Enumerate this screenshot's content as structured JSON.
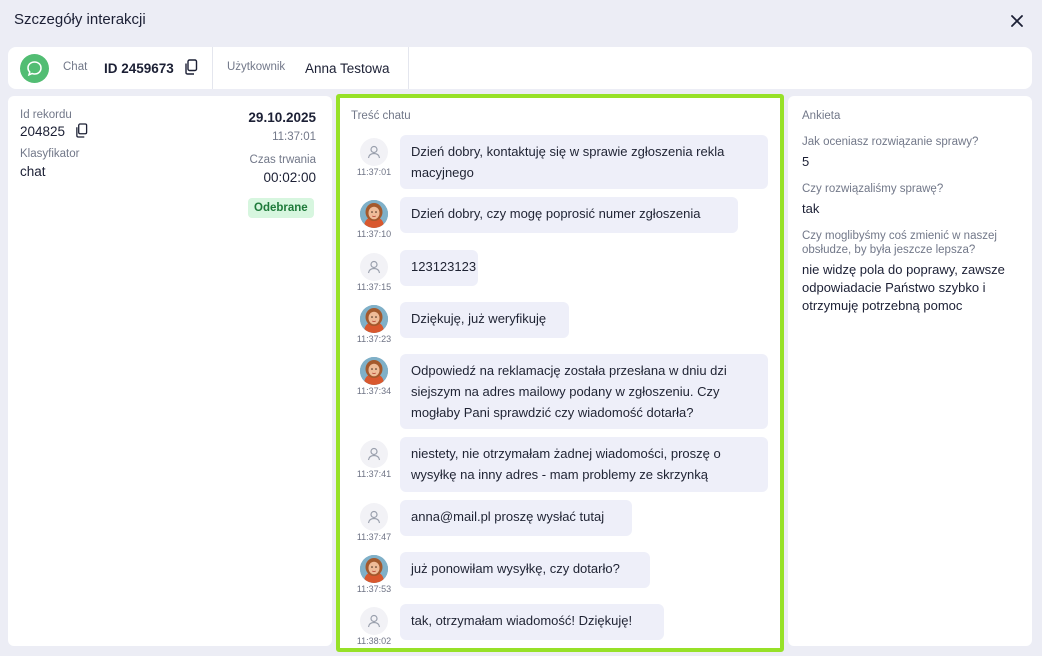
{
  "window": {
    "title": "Szczegóły interakcji"
  },
  "info_bar": {
    "type_label": "Chat",
    "interaction_id": "ID 2459673",
    "user_label": "Użytkownik",
    "user_name": "Anna Testowa"
  },
  "record": {
    "id_label": "Id rekordu",
    "id_value": "204825",
    "classifier_label": "Klasyfikator",
    "classifier_value": "chat",
    "date": "29.10.2025",
    "time": "11:37:01",
    "duration_label": "Czas trwania",
    "duration_value": "00:02:00",
    "status": "Odebrane"
  },
  "chat": {
    "section_label": "Treść chatu",
    "messages": [
      {
        "sender": "client",
        "time": "11:37:01",
        "text": "Dzień dobry, kontaktuję się w sprawie zgłoszenia rekla macyjnego"
      },
      {
        "sender": "agent",
        "time": "11:37:10",
        "text": "Dzień dobry, czy mogę poprosić numer zgłoszenia"
      },
      {
        "sender": "client",
        "time": "11:37:15",
        "text": "123123123"
      },
      {
        "sender": "agent",
        "time": "11:37:23",
        "text": "Dziękuję, już weryfikuję"
      },
      {
        "sender": "agent",
        "time": "11:37:34",
        "text": "Odpowiedź na reklamację została przesłana w dniu dzi siejszym na adres mailowy podany w zgłoszeniu. Czy mogłaby Pani sprawdzić czy wiadomość dotarła?"
      },
      {
        "sender": "client",
        "time": "11:37:41",
        "text": "niestety, nie otrzymałam żadnej wiadomości, proszę o wysyłkę na inny adres - mam problemy ze skrzynką"
      },
      {
        "sender": "client",
        "time": "11:37:47",
        "text": "anna@mail.pl proszę wysłać tutaj"
      },
      {
        "sender": "agent",
        "time": "11:37:53",
        "text": "już ponowiłam wysyłkę, czy dotarło?"
      },
      {
        "sender": "client",
        "time": "11:38:02",
        "text": "tak, otrzymałam wiadomość! Dziękuję!"
      }
    ]
  },
  "survey": {
    "section_label": "Ankieta",
    "items": [
      {
        "question": "Jak oceniasz rozwiązanie sprawy?",
        "answer": "5"
      },
      {
        "question": "Czy rozwiązaliśmy sprawę?",
        "answer": "tak"
      },
      {
        "question": "Czy moglibyśmy coś zmienić w naszej obsłudze, by była jeszcze lepsza?",
        "answer": "nie widzę pola do poprawy, zawsze odpowiadacie Państwo szybko i otrzymuję potrzebną pomoc"
      }
    ]
  },
  "colors": {
    "highlight": "#97e128",
    "chat_icon": "#52bd73",
    "status_bg": "#d7f6df",
    "status_text": "#1e7a3a",
    "bubble": "#eeeff9"
  },
  "icons": {
    "close": "close-icon",
    "chat": "chat-bubble-icon",
    "copy": "copy-icon",
    "user": "user-icon"
  }
}
